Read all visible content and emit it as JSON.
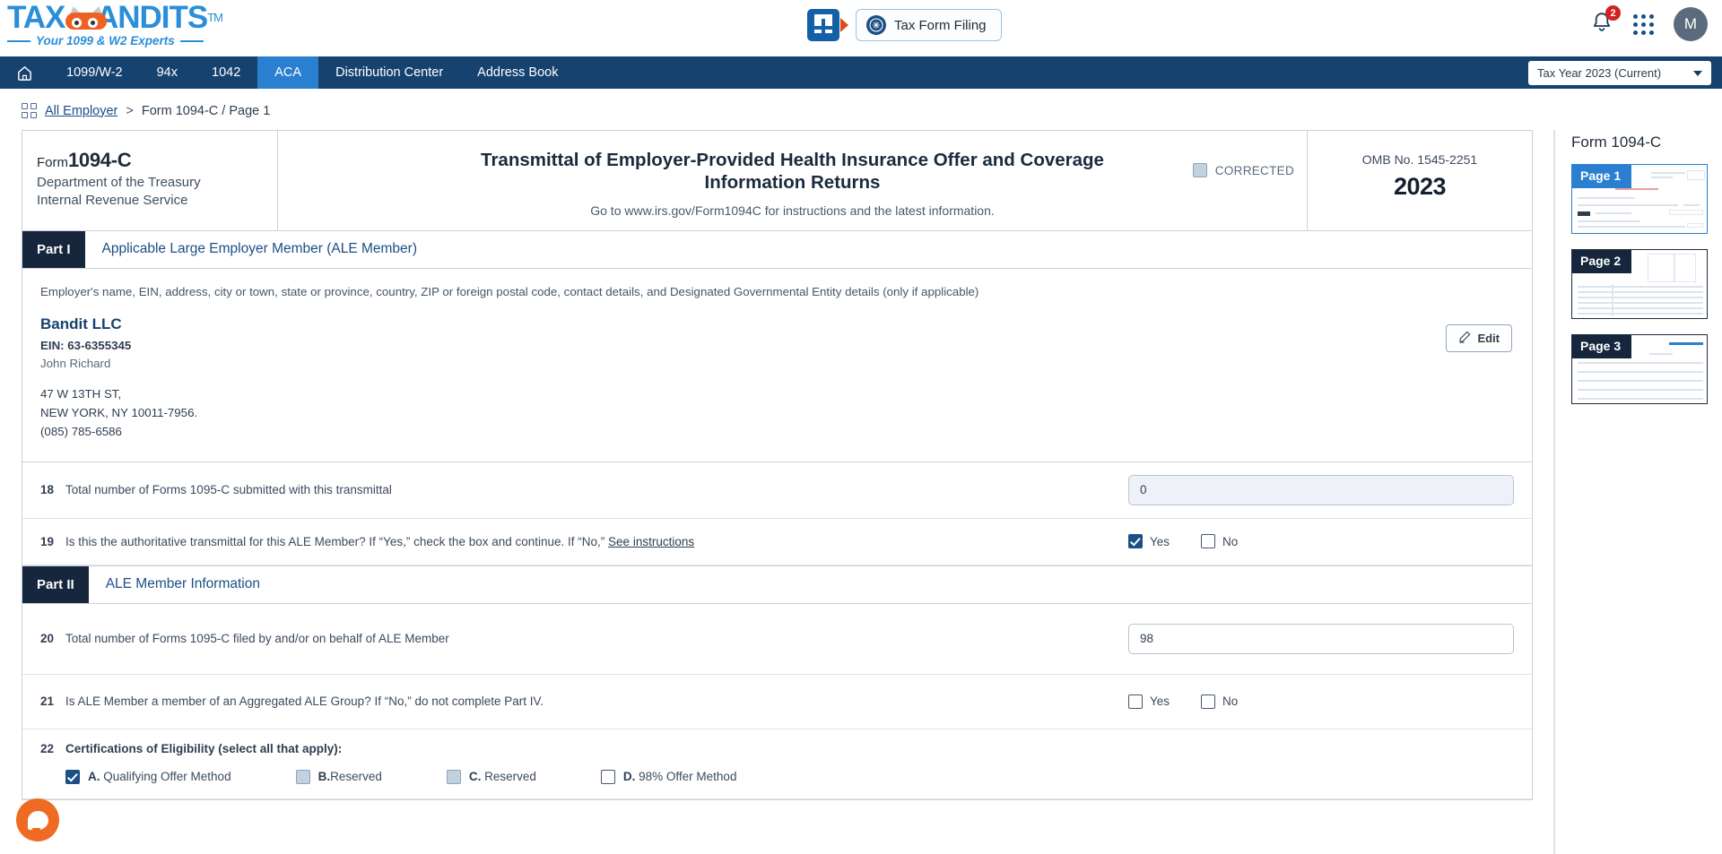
{
  "topbar": {
    "logo": {
      "main_a": "TAX",
      "main_b": "ANDITS",
      "tm": "TM",
      "tagline": "Your 1099 & W2 Experts"
    },
    "gift_icon": "gift-icon",
    "tax_form_filing_label": "Tax Form Filing",
    "notification_count": "2",
    "avatar_initial": "M"
  },
  "nav": {
    "home_icon": "home-icon",
    "items": [
      {
        "label": "1099/W-2",
        "active": false
      },
      {
        "label": "94x",
        "active": false
      },
      {
        "label": "1042",
        "active": false
      },
      {
        "label": "ACA",
        "active": true
      },
      {
        "label": "Distribution Center",
        "active": false
      },
      {
        "label": "Address Book",
        "active": false
      }
    ],
    "tax_year": "Tax Year 2023 (Current)"
  },
  "breadcrumb": {
    "link": "All Employer",
    "separator": ">",
    "current": "Form 1094-C / Page 1"
  },
  "form_header": {
    "form_prefix": "Form",
    "form_number": "1094-C",
    "dept_line1": "Department of the Treasury",
    "dept_line2": "Internal Revenue Service",
    "title": "Transmittal of Employer-Provided Health Insurance Offer and Coverage Information Returns",
    "goto": "Go to www.irs.gov/Form1094C for instructions and the latest information.",
    "corrected_label": "CORRECTED",
    "corrected_checked": false,
    "omb": "OMB No. 1545-2251",
    "year": "2023"
  },
  "part1": {
    "tag": "Part I",
    "title": "Applicable Large Employer Member (ALE Member)",
    "instruction": "Employer's name, EIN, address, city or town, state or province, country, ZIP or foreign postal code, contact details, and Designated Governmental Entity details (only if applicable)",
    "employer_name": "Bandit LLC",
    "ein": "EIN: 63-6355345",
    "contact_name": "John Richard",
    "address_line1": "47 W 13TH ST,",
    "address_line2": "NEW YORK, NY 10011-7956.",
    "phone": "(085) 785-6586",
    "edit_label": "Edit",
    "edit_icon": "pencil-icon"
  },
  "lines": {
    "l18": {
      "number": "18",
      "text": "Total number of Forms 1095-C submitted with this transmittal",
      "value": "0",
      "disabled": true
    },
    "l19": {
      "number": "19",
      "text_before": "Is this the authoritative transmittal for this ALE Member? If “Yes,” check the box and continue. If “No,” ",
      "link": "See instructions",
      "yes_label": "Yes",
      "no_label": "No",
      "yes_checked": true,
      "no_checked": false
    },
    "l20": {
      "number": "20",
      "text": "Total number of Forms 1095-C filed by and/or on behalf of ALE Member",
      "value": "98",
      "disabled": false
    },
    "l21": {
      "number": "21",
      "text": "Is ALE Member a member of an Aggregated ALE Group? If “No,” do not complete Part IV.",
      "yes_label": "Yes",
      "no_label": "No",
      "yes_checked": false,
      "no_checked": false
    },
    "l22": {
      "number": "22",
      "text": "Certifications of Eligibility (select all that apply):",
      "options": [
        {
          "letter": "A.",
          "label": " Qualifying Offer Method",
          "state": "checked"
        },
        {
          "letter": "B.",
          "label": "Reserved",
          "state": "disabled"
        },
        {
          "letter": "C.",
          "label": " Reserved",
          "state": "disabled"
        },
        {
          "letter": "D.",
          "label": " 98% Offer Method",
          "state": "unchecked"
        }
      ]
    }
  },
  "part2": {
    "tag": "Part II",
    "title": "ALE Member Information"
  },
  "pages_panel": {
    "title": "Form 1094-C",
    "pages": [
      {
        "label": "Page 1",
        "active": true
      },
      {
        "label": "Page 2",
        "active": false
      },
      {
        "label": "Page 3",
        "active": false
      }
    ]
  },
  "chat": {
    "icon": "chat-bubble-icon"
  },
  "colors": {
    "nav_bg": "#15426e",
    "nav_active": "#2b7fd0",
    "accent_blue": "#1b4f86",
    "dark_navy": "#16263c",
    "orange": "#ef6a22",
    "badge_red": "#d32121"
  }
}
